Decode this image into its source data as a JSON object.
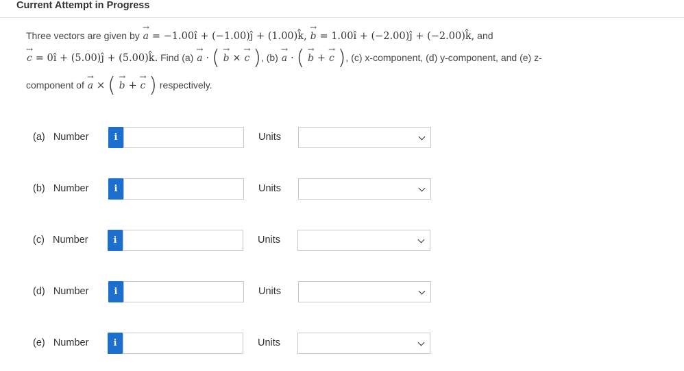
{
  "header": {
    "title": "Current Attempt in Progress"
  },
  "question": {
    "intro": "Three vectors are given by",
    "vec_a": "a",
    "vec_b": "b",
    "vec_c": "c",
    "a_expr": "= −1.00î + (−1.00)ĵ + (1.00)k̂,",
    "b_expr": "= 1.00î + (−2.00)ĵ + (−2.00)k̂,",
    "and": "and",
    "c_expr": "= 0î + (5.00)ĵ + (5.00)k̂.",
    "find": "Find (a)",
    "dot": "·",
    "cross": "×",
    "plus": "+",
    "part_b_sep": ", (b)",
    "part_c_tail": ", (c) x-component, (d) y-component, and (e) z-",
    "component_of": "component of",
    "respectively": "respectively."
  },
  "rows": [
    {
      "label": "(a)",
      "number_label": "Number",
      "info": "i",
      "units_label": "Units",
      "value": "",
      "unit_selected": ""
    },
    {
      "label": "(b)",
      "number_label": "Number",
      "info": "i",
      "units_label": "Units",
      "value": "",
      "unit_selected": ""
    },
    {
      "label": "(c)",
      "number_label": "Number",
      "info": "i",
      "units_label": "Units",
      "value": "",
      "unit_selected": ""
    },
    {
      "label": "(d)",
      "number_label": "Number",
      "info": "i",
      "units_label": "Units",
      "value": "",
      "unit_selected": ""
    },
    {
      "label": "(e)",
      "number_label": "Number",
      "info": "i",
      "units_label": "Units",
      "value": "",
      "unit_selected": ""
    }
  ],
  "colors": {
    "info_button": "#1d6fcf",
    "border": "#c8c8c8",
    "text": "#333333"
  }
}
